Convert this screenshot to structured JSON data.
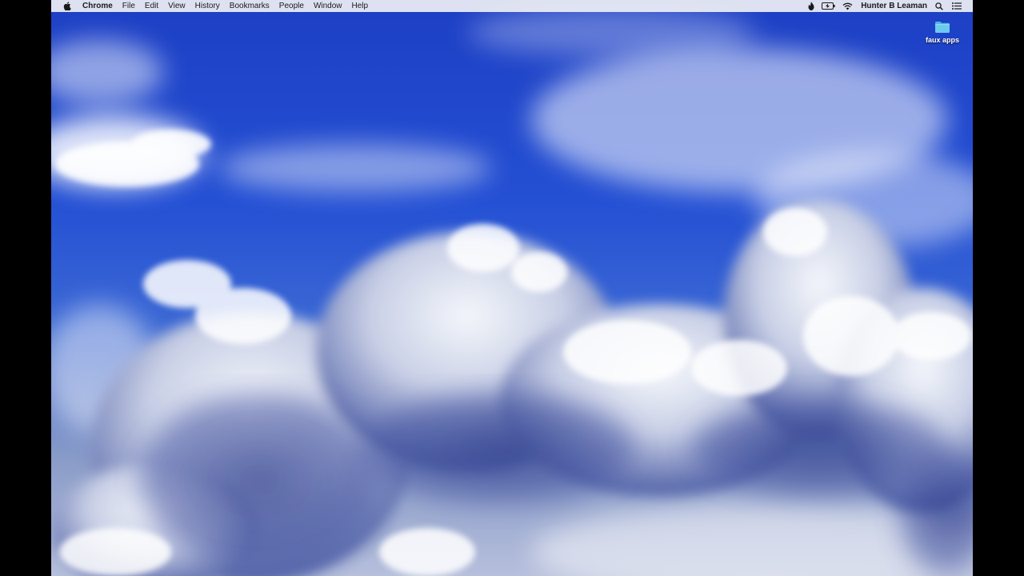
{
  "menubar": {
    "apple_icon": "apple-icon",
    "app_name": "Chrome",
    "menus": [
      "File",
      "Edit",
      "View",
      "History",
      "Bookmarks",
      "People",
      "Window",
      "Help"
    ],
    "status_icons": [
      "fire-icon",
      "battery-charging-icon",
      "wifi-icon"
    ],
    "user_name": "Hunter B Leaman",
    "spotlight_icon": "search-icon",
    "notification_icon": "list-icon"
  },
  "desktop": {
    "folder_label": "faux apps",
    "folder_icon": "folder-icon"
  },
  "colors": {
    "sky": "#2a56d8",
    "menubar": "#eceef4",
    "folder": "#5cc3ef"
  }
}
